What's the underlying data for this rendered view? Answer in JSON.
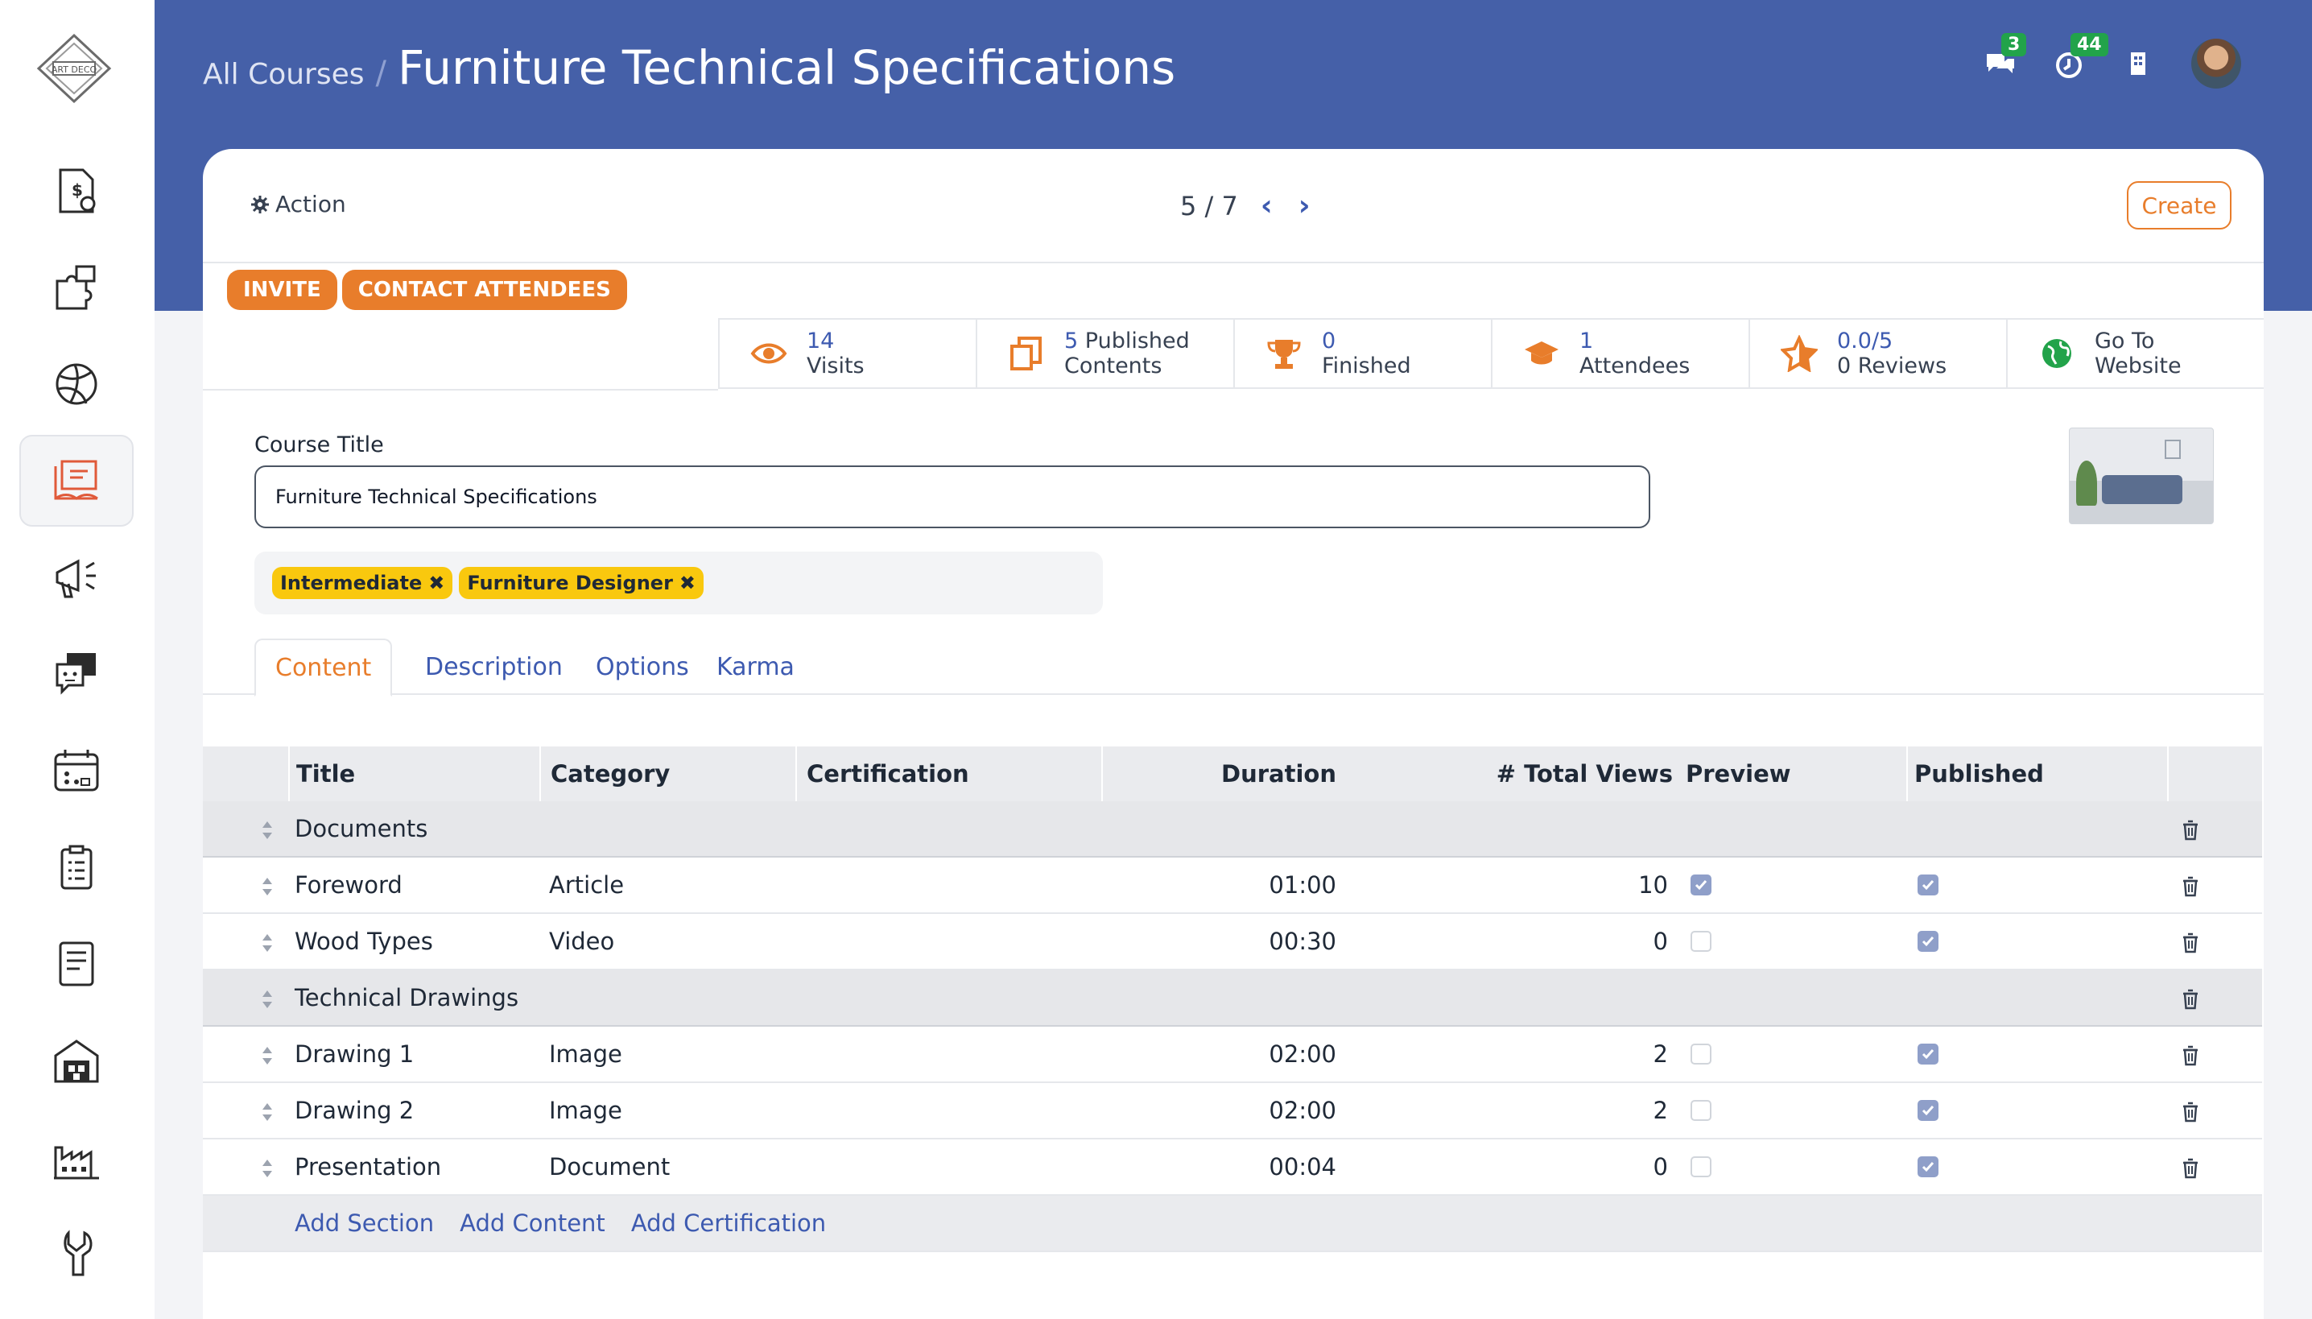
{
  "breadcrumb": {
    "parent": "All Courses",
    "separator": "/",
    "title": "Furniture Technical Specifications"
  },
  "header": {
    "messages_count": "3",
    "activities_count": "44"
  },
  "control_panel": {
    "action_label": "Action",
    "pager": "5 / 7",
    "create_label": "Create"
  },
  "status_buttons": {
    "invite": "INVITE",
    "contact": "CONTACT ATTENDEES"
  },
  "stats": [
    {
      "value": "14",
      "label": "Visits",
      "icon": "eye-icon"
    },
    {
      "value": "5",
      "label": "Published",
      "label2": "Contents",
      "icon": "documents-icon"
    },
    {
      "value": "0",
      "label": "Finished",
      "icon": "trophy-icon"
    },
    {
      "value": "1",
      "label": "Attendees",
      "icon": "graduation-cap-icon"
    },
    {
      "value": "0.0/5",
      "label": "0 Reviews",
      "icon": "star-icon"
    },
    {
      "value": "Go To",
      "label": "Website",
      "icon": "globe-icon"
    }
  ],
  "form": {
    "title_label": "Course Title",
    "title_value": "Furniture Technical Specifications"
  },
  "tags": [
    "Intermediate",
    "Furniture Designer"
  ],
  "tabs": [
    "Content",
    "Description",
    "Options",
    "Karma"
  ],
  "table": {
    "headers": {
      "title": "Title",
      "category": "Category",
      "certification": "Certification",
      "duration": "Duration",
      "views": "# Total Views",
      "preview": "Preview",
      "published": "Published"
    },
    "rows": [
      {
        "type": "section",
        "title": "Documents"
      },
      {
        "type": "item",
        "title": "Foreword",
        "category": "Article",
        "duration": "01:00",
        "views": "10",
        "preview": true,
        "published": true
      },
      {
        "type": "item",
        "title": "Wood Types",
        "category": "Video",
        "duration": "00:30",
        "views": "0",
        "preview": false,
        "published": true
      },
      {
        "type": "section",
        "title": "Technical Drawings"
      },
      {
        "type": "item",
        "title": "Drawing 1",
        "category": "Image",
        "duration": "02:00",
        "views": "2",
        "preview": false,
        "published": true
      },
      {
        "type": "item",
        "title": "Drawing 2",
        "category": "Image",
        "duration": "02:00",
        "views": "2",
        "preview": false,
        "published": true
      },
      {
        "type": "item",
        "title": "Presentation",
        "category": "Document",
        "duration": "00:04",
        "views": "0",
        "preview": false,
        "published": true
      }
    ],
    "footer_links": [
      "Add Section",
      "Add Content",
      "Add Certification"
    ]
  },
  "sidebar": {
    "logo_text": "ART DECO",
    "items": [
      "invoice-icon",
      "puzzle-icon",
      "globe-ball-icon",
      "elearning-icon",
      "megaphone-icon",
      "chat-face-icon",
      "calendar-icon",
      "clipboard-icon",
      "document-icon",
      "warehouse-icon",
      "factory-icon",
      "wrench-icon"
    ]
  },
  "colors": {
    "header": "#4560a8",
    "accent": "#e87d2b",
    "link": "#3d5ab0",
    "tag": "#f9c80e",
    "badge": "#22a34a"
  }
}
